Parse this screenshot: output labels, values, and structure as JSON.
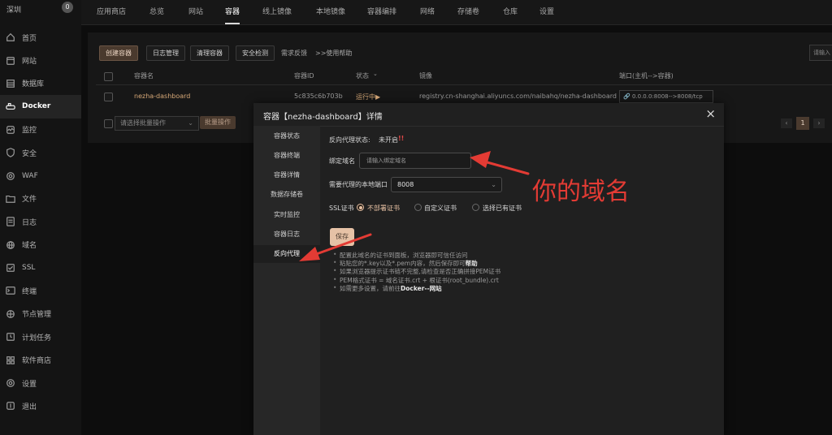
{
  "brand": {
    "name": "深圳",
    "badge": "0"
  },
  "sidebar": {
    "items": [
      {
        "label": "首页",
        "icon": "home-icon"
      },
      {
        "label": "网站",
        "icon": "globe-icon"
      },
      {
        "label": "数据库",
        "icon": "database-icon"
      },
      {
        "label": "Docker",
        "icon": "docker-icon"
      },
      {
        "label": "监控",
        "icon": "monitor-icon"
      },
      {
        "label": "安全",
        "icon": "shield-icon"
      },
      {
        "label": "WAF",
        "icon": "waf-icon"
      },
      {
        "label": "文件",
        "icon": "folder-icon"
      },
      {
        "label": "日志",
        "icon": "log-icon"
      },
      {
        "label": "域名",
        "icon": "domain-icon"
      },
      {
        "label": "SSL",
        "icon": "ssl-icon"
      },
      {
        "label": "终端",
        "icon": "terminal-icon"
      },
      {
        "label": "节点管理",
        "icon": "node-icon"
      },
      {
        "label": "计划任务",
        "icon": "clock-icon"
      },
      {
        "label": "软件商店",
        "icon": "store-icon"
      },
      {
        "label": "设置",
        "icon": "gear-icon"
      },
      {
        "label": "退出",
        "icon": "logout-icon"
      }
    ],
    "active_index": 3
  },
  "topnav": {
    "items": [
      "应用商店",
      "总览",
      "网站",
      "容器",
      "线上镜像",
      "本地镜像",
      "容器编排",
      "网络",
      "存储卷",
      "仓库",
      "设置"
    ],
    "active_index": 3
  },
  "toolbar": {
    "create": "创建容器",
    "logs": "日志管理",
    "clean": "清理容器",
    "security": "安全检测",
    "feedback": "需求反馈",
    "help": ">>使用帮助",
    "search_placeholder": "请输入"
  },
  "table": {
    "headers": [
      "容器名",
      "容器ID",
      "状态",
      "镜像",
      "端口(主机-->容器)"
    ],
    "rows": [
      {
        "name": "nezha-dashboard",
        "id": "5c835c6b703b",
        "status": "运行中▶",
        "image": "registry.cn-shanghai.aliyuncs.com/naibahq/nezha-dashboard",
        "ports": "0.0.0.0:8008-->8008/tcp"
      }
    ]
  },
  "batch": {
    "placeholder": "请选择批量操作",
    "button": "批量操作"
  },
  "pager": {
    "prev": "‹",
    "current": "1",
    "next": "›"
  },
  "modal": {
    "title": "容器【nezha-dashboard】详情",
    "close": "×",
    "menu": [
      "容器状态",
      "容器终端",
      "容器详情",
      "数据存储卷",
      "实时监控",
      "容器日志",
      "反向代理"
    ],
    "active_menu": 6,
    "proxy_status_label": "反向代理状态:",
    "proxy_status_value": "未开启",
    "proxy_status_mark": "!!",
    "domain_label": "绑定域名",
    "domain_placeholder": "请输入绑定域名",
    "port_label": "需要代理的本地端口",
    "port_value": "8008",
    "ssl_label": "SSL证书",
    "ssl_options": [
      "不部署证书",
      "自定义证书",
      "选择已有证书"
    ],
    "ssl_selected": 0,
    "save": "保存",
    "help": [
      {
        "text": "配置此域名的证书到面板，浏览器即可信任访问",
        "bold": ""
      },
      {
        "text": "粘贴您的*.key以及*.pem内容，然后保存即可",
        "bold": "帮助"
      },
      {
        "text": "如果浏览器提示证书链不完整,请检查是否正确拼接PEM证书",
        "bold": ""
      },
      {
        "text": "PEM格式证书 = 域名证书.crt + 根证书(root_bundle).crt",
        "bold": ""
      },
      {
        "text": "如需更多设置，请前往",
        "bold": "Docker--网站"
      }
    ]
  },
  "annotation": {
    "text": "你的域名",
    "color": "#e33b34"
  }
}
